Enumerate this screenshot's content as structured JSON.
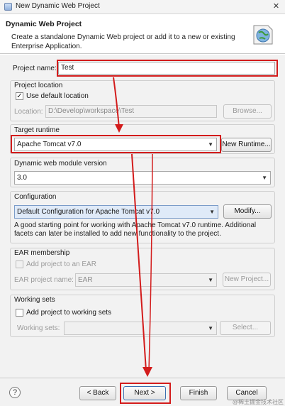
{
  "window": {
    "title": "New Dynamic Web Project",
    "close_glyph": "✕"
  },
  "banner": {
    "title": "Dynamic Web Project",
    "description": "Create a standalone Dynamic Web project or add it to a new or existing Enterprise Application.",
    "icon": "web-project-globe-icon"
  },
  "project": {
    "name_label": "Project name:",
    "name_value": "Test"
  },
  "location": {
    "group_title": "Project location",
    "use_default_label": "Use default location",
    "use_default_checked": true,
    "location_label": "Location:",
    "location_value": "D:\\Develop\\workspace\\Test",
    "browse_button": "Browse..."
  },
  "runtime": {
    "group_title": "Target runtime",
    "selected": "Apache Tomcat v7.0",
    "new_button": "New Runtime..."
  },
  "module": {
    "group_title": "Dynamic web module version",
    "selected": "3.0"
  },
  "configuration": {
    "group_title": "Configuration",
    "selected": "Default Configuration for Apache Tomcat v7.0",
    "modify_button": "Modify...",
    "description": "A good starting point for working with Apache Tomcat v7.0 runtime. Additional facets can later be installed to add new functionality to the project."
  },
  "ear": {
    "group_title": "EAR membership",
    "add_label": "Add project to an EAR",
    "add_checked": false,
    "project_name_label": "EAR project name:",
    "project_name_value": "EAR",
    "new_project_button": "New Project..."
  },
  "working_sets": {
    "group_title": "Working sets",
    "add_label": "Add project to working sets",
    "add_checked": false,
    "label": "Working sets:",
    "select_button": "Select..."
  },
  "footer": {
    "help_glyph": "?",
    "back_button": "< Back",
    "next_button": "Next >",
    "finish_button": "Finish",
    "cancel_button": "Cancel",
    "watermark": "@稀土掘金技术社区"
  },
  "colors": {
    "annotation_red": "#d31c1c"
  }
}
